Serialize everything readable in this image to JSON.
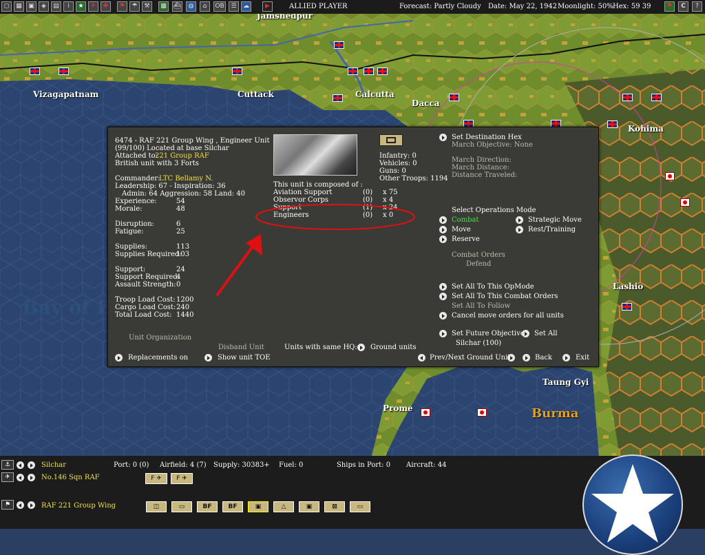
{
  "topbar": {
    "player": "ALLIED PLAYER",
    "forecast": "Forecast: Partly Cloudy",
    "date": "Date: May 22, 1942",
    "moonlight": "Moonlight: 50%",
    "hex": "Hex: 59 39",
    "icons": [
      "map-view-icon",
      "grid-icon",
      "ships-icon",
      "air-icon",
      "info-icon",
      "star-icon",
      "aircraft-icon",
      "ground-icon",
      "flag-icon",
      "weather-icon",
      "supply-icon",
      "convoy-icon",
      "globe-icon",
      "base-icon",
      "ob-label",
      "report-icon",
      "cloud-icon",
      "play-icon"
    ],
    "ob_label": "OB",
    "right_icons": [
      "flag-icon",
      "close-icon",
      "help-icon"
    ],
    "close_label": "C"
  },
  "map": {
    "labels": {
      "jamshedpur": "Jamshedpur",
      "vizagapatnam": "Vizagapatnam",
      "cuttack": "Cuttack",
      "calcutta": "Calcutta",
      "dacca": "Dacca",
      "kohima": "Kohima",
      "lashio": "Lashio",
      "taung_gyi": "Taung Gyi",
      "prome": "Prome",
      "burma": "Burma",
      "bay_of_bengal": "Bay of B"
    }
  },
  "panel": {
    "unit_title": "6474 - RAF 221 Group Wing , Engineer Unit",
    "location": "(99/100) Located at base Silchar",
    "attached_label": "Attached to:",
    "attached_value": "221 Group RAF",
    "forts": "British unit with 3 Forts",
    "commander_label": "Commander:",
    "commander_value": "LTC Bellamy N.",
    "leadership": "Leadership: 67 - Inspiration: 36",
    "admin": "Admin: 64  Aggression: 58  Land: 40",
    "stats": [
      {
        "label": "Experience:",
        "value": "54"
      },
      {
        "label": "Morale:",
        "value": "48"
      },
      {
        "label": "Disruption:",
        "value": "6"
      },
      {
        "label": "Fatigue:",
        "value": "25"
      },
      {
        "label": "Supplies:",
        "value": "113"
      },
      {
        "label": "Supplies Required:",
        "value": "103"
      },
      {
        "label": "Support:",
        "value": "24"
      },
      {
        "label": "Support Required:",
        "value": "4"
      },
      {
        "label": "Assault Strength:",
        "value": "0"
      },
      {
        "label": "Troop Load Cost:",
        "value": "1200"
      },
      {
        "label": "Cargo Load Cost:",
        "value": "240"
      },
      {
        "label": "Total Load Cost:",
        "value": "1440"
      }
    ],
    "unit_organization": "Unit Organization",
    "troops": {
      "infantry": "Infantry: 0",
      "vehicles": "Vehicles: 0",
      "guns": "Guns: 0",
      "other": "Other Troops: 1194"
    },
    "composed_of": "This unit is composed of :",
    "components": [
      {
        "name": "Aviation Support",
        "count": "(0)",
        "mult": "x 75"
      },
      {
        "name": "Observor Corps",
        "count": "(0)",
        "mult": "x 4"
      },
      {
        "name": "Support",
        "count": "(1)",
        "mult": "x 24"
      },
      {
        "name": "Engineers",
        "count": "(0)",
        "mult": "x 0"
      }
    ],
    "right": {
      "set_destination": "Set Destination Hex",
      "march_objective": "March Objective: None",
      "march_direction": "March Direction:",
      "march_distance": "March Distance:",
      "distance_traveled": "Distance Traveled:",
      "select_ops_mode": "Select Operations Mode",
      "combat": "Combat",
      "strategic_move": "Strategic Move",
      "move": "Move",
      "rest_training": "Rest/Training",
      "reserve": "Reserve",
      "combat_orders": "Combat Orders",
      "defend": "Defend",
      "set_all_opmode": "Set All To This OpMode",
      "set_all_combat_orders": "Set All To This Combat Orders",
      "set_all_follow": "Set All To Follow",
      "cancel_move": "Cancel move orders for all units",
      "set_future_objective": "Set Future Objective",
      "set_all": "Set All",
      "future_value": "Silchar (100)"
    },
    "bottom": {
      "disband_unit": "Disband Unit",
      "units_same_hq": "Units with same HQ:",
      "ground_units": "Ground units",
      "replacements": "Replacements on",
      "show_toe": "Show unit TOE",
      "prev_next": "Prev/Next Ground Unit",
      "back": "Back",
      "exit": "Exit"
    }
  },
  "bottombar": {
    "base_name": "Silchar",
    "port": "Port: 0 (0)",
    "airfield": "Airfield: 4 (7)",
    "supply": "Supply: 30383+",
    "fuel": "Fuel: 0",
    "ships_in_port": "Ships in Port: 0",
    "aircraft": "Aircraft: 44",
    "squadron": "No.146 Sqn RAF",
    "unit_name": "RAF 221 Group Wing",
    "aircraft_buttons": [
      "F",
      "F"
    ],
    "unit_buttons": [
      "",
      "",
      "BF",
      "BF",
      "",
      "",
      "",
      "",
      ""
    ]
  },
  "colors": {
    "panel_bg": "#3a3a36",
    "highlight_yellow": "#f0e040",
    "active_green": "#4fe04f",
    "annotation_red": "#e01010"
  }
}
